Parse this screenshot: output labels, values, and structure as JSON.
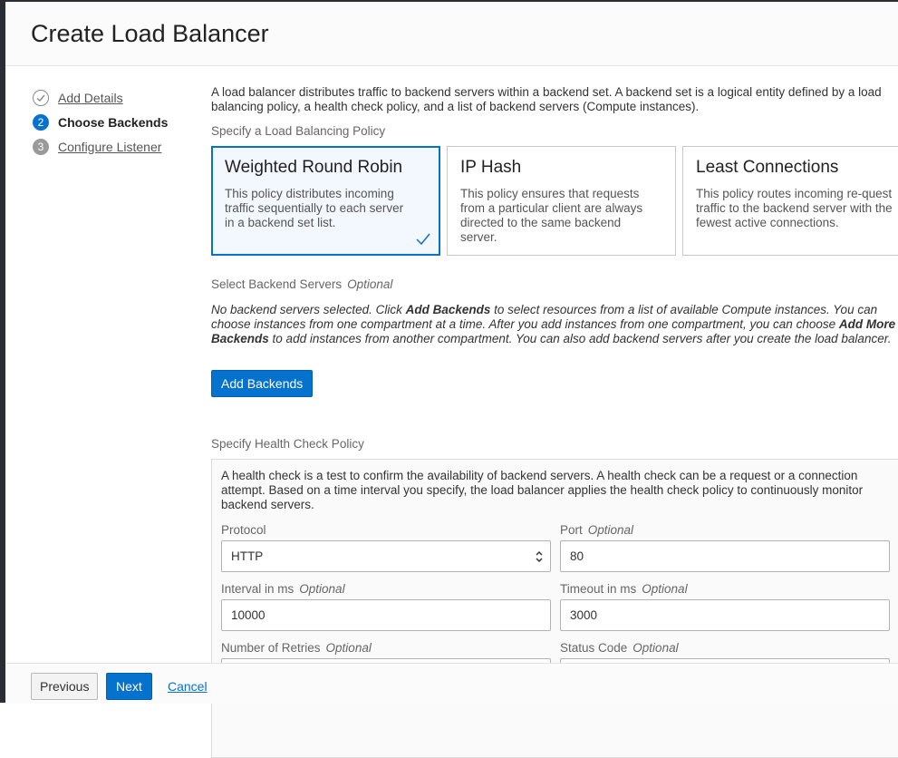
{
  "header": {
    "title": "Create Load Balancer"
  },
  "steps": [
    {
      "number": "",
      "label": "Add Details",
      "state": "done"
    },
    {
      "number": "2",
      "label": "Choose Backends",
      "state": "active"
    },
    {
      "number": "3",
      "label": "Configure Listener",
      "state": "pending"
    }
  ],
  "intro": {
    "line1": "A load balancer distributes traffic to backend servers within a backend set. A backend set is a logical entity defined by a load",
    "line2": "balancing policy, a health check policy, and a list of backend servers (Compute instances)."
  },
  "policy_section": {
    "label": "Specify a Load Balancing Policy",
    "cards": [
      {
        "title": "Weighted Round Robin",
        "description": "This policy distributes incoming traffic sequentially to each server in a backend set list.",
        "selected": true
      },
      {
        "title": "IP Hash",
        "description": "This policy ensures that requests from a particular client are always directed to the same backend server.",
        "selected": false
      },
      {
        "title": "Least Connections",
        "description": "This policy routes incoming re-quest traffic to the backend server with the fewest active connections.",
        "selected": false
      }
    ]
  },
  "backends_section": {
    "label": "Select Backend Servers",
    "optional": "Optional",
    "text_1": "No backend servers selected. Click ",
    "text_bold_1": "Add Backends",
    "text_2": " to select resources from a list of available Compute instances. You can choose instances from one compartment at a time. After you add instances from one compartment, you can choose ",
    "text_bold_2": "Add More Backends",
    "text_3": " to add instances from another compartment. You can also add backend servers after you create the load balancer.",
    "button_label": "Add Backends"
  },
  "health_section": {
    "label": "Specify Health Check Policy",
    "description": "A health check is a test to confirm the availability of backend servers. A health check can be a request or a connection attempt. Based on a time interval you specify, the load balancer applies the health check policy to continuously monitor backend servers.",
    "protocol_label": "Protocol",
    "protocol_value": "HTTP",
    "port_label": "Port",
    "port_optional": "Optional",
    "port_value": "80",
    "interval_label": "Interval in ms",
    "interval_optional": "Optional",
    "interval_value": "10000",
    "timeout_label": "Timeout in ms",
    "timeout_optional": "Optional",
    "timeout_value": "3000",
    "retries_label": "Number of Retries",
    "retries_optional": "Optional",
    "status_label": "Status Code",
    "status_optional": "Optional"
  },
  "footer": {
    "previous_label": "Previous",
    "next_label": "Next",
    "cancel_label": "Cancel"
  },
  "colors": {
    "accent": "#0572ce"
  }
}
